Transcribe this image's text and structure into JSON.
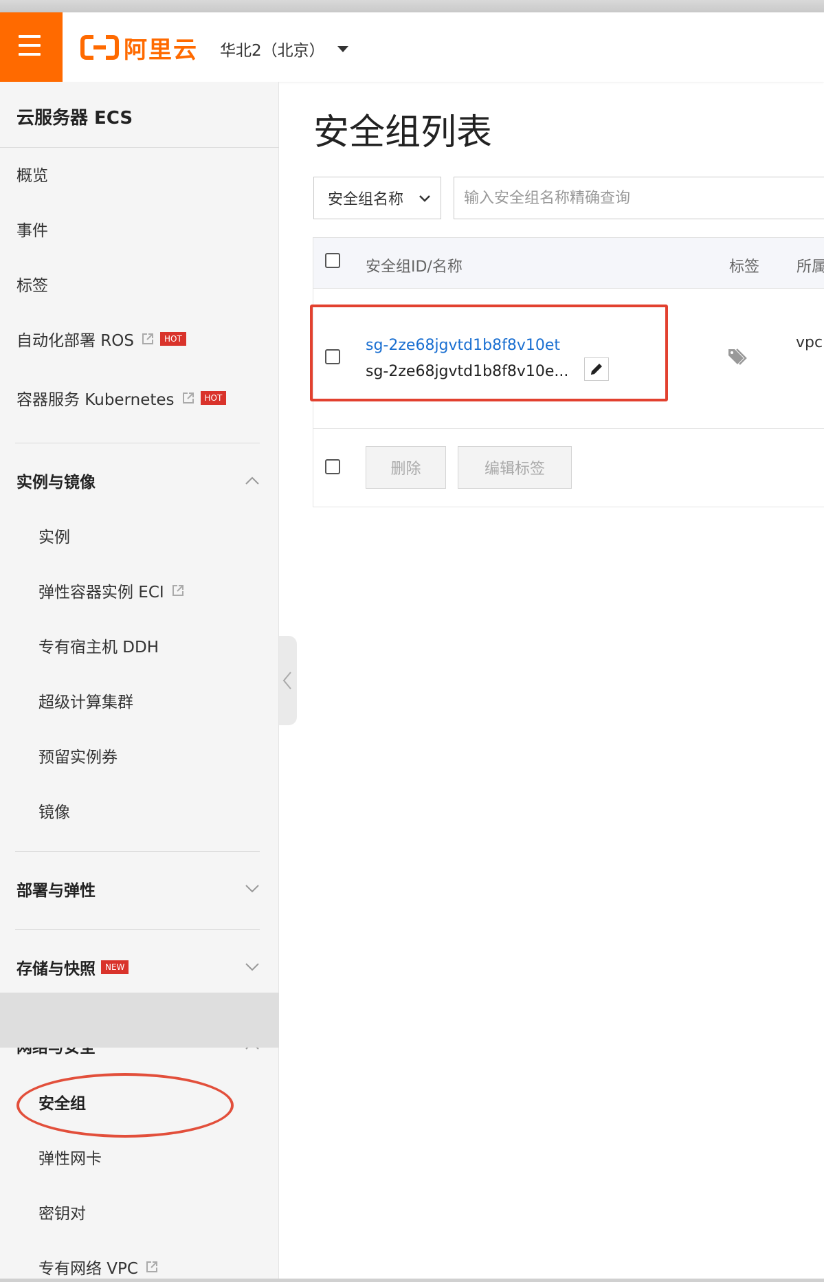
{
  "header": {
    "brand": "阿里云",
    "region": "华北2（北京）"
  },
  "sidebar": {
    "title": "云服务器 ECS",
    "top_items": [
      {
        "label": "概览"
      },
      {
        "label": "事件"
      },
      {
        "label": "标签"
      },
      {
        "label": "自动化部署 ROS",
        "badge": "HOT"
      },
      {
        "label": "容器服务 Kubernetes",
        "badge": "HOT"
      }
    ],
    "groups": {
      "instances": {
        "label": "实例与镜像",
        "items": [
          "实例",
          "弹性容器实例 ECI",
          "专有宿主机 DDH",
          "超级计算集群",
          "预留实例券",
          "镜像"
        ]
      },
      "deploy": {
        "label": "部署与弹性"
      },
      "storage": {
        "label": "存储与快照",
        "badge": "NEW"
      },
      "network": {
        "label": "网络与安全",
        "items": [
          "安全组",
          "弹性网卡",
          "密钥对",
          "专有网络 VPC"
        ]
      }
    }
  },
  "main": {
    "title": "安全组列表",
    "filter": {
      "selected": "安全组名称",
      "placeholder": "输入安全组名称精确查询"
    },
    "table": {
      "headers": [
        "安全组ID/名称",
        "标签",
        "所属"
      ],
      "rows": [
        {
          "id": "sg-2ze68jgvtd1b8f8v10et",
          "name": "sg-2ze68jgvtd1b8f8v10e...",
          "vpc": "vpc"
        }
      ],
      "actions": {
        "delete": "删除",
        "edit_tags": "编辑标签"
      }
    }
  },
  "colors": {
    "brand": "#ff6a00",
    "link": "#1a6fd1",
    "badge": "#d9332b",
    "highlight": "#e2412f"
  }
}
